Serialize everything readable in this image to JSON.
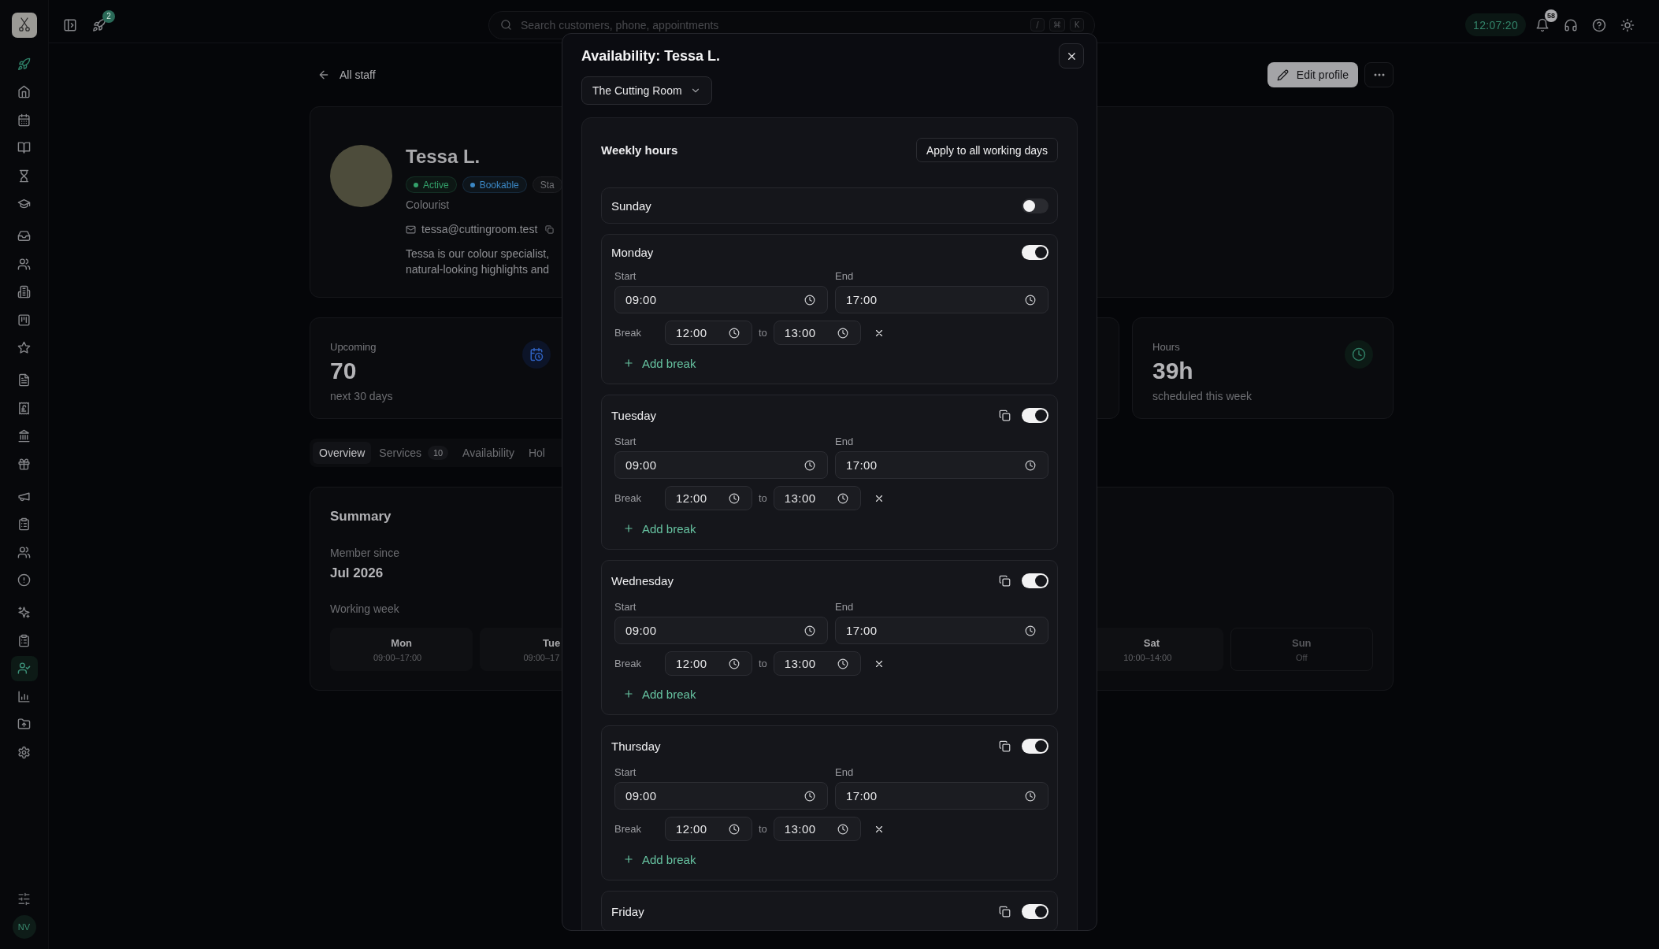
{
  "sidebar": {
    "groups": [
      [
        {
          "selected": false
        },
        {
          "selected": false
        },
        {
          "selected": false
        },
        {
          "selected": false
        },
        {
          "selected": false
        },
        {
          "selected": false
        }
      ],
      [
        {
          "selected": false
        },
        {
          "selected": false
        },
        {
          "selected": false
        },
        {
          "selected": false
        },
        {
          "selected": false
        }
      ],
      [
        {
          "selected": false
        },
        {
          "selected": false
        },
        {
          "selected": false
        },
        {
          "selected": false
        }
      ],
      [
        {
          "selected": false
        },
        {
          "selected": false
        },
        {
          "selected": false
        },
        {
          "selected": false
        }
      ],
      [
        {
          "selected": false
        },
        {
          "selected": false
        },
        {
          "selected": true
        },
        {
          "selected": false
        },
        {
          "selected": false
        },
        {
          "selected": false
        }
      ]
    ],
    "user_initials": "NV"
  },
  "top_bar": {
    "updates_badge": "2",
    "search": {
      "placeholder": "Search customers, phone, appointments",
      "shortcut_keys": [
        "/",
        "⌘",
        "K"
      ]
    },
    "clock": "12:07:20",
    "notifications_badge": "58"
  },
  "page": {
    "back_link": "All staff",
    "edit_button": "Edit profile",
    "profile": {
      "name": "Tessa L.",
      "badges": [
        {
          "label": "Active",
          "color": "#34a26b"
        },
        {
          "label": "Bookable",
          "color": "#3b87c4"
        },
        {
          "label": "Sta"
        }
      ],
      "role": "Colourist",
      "email": "tessa@cuttingroom.test",
      "bio_lines": [
        "Tessa is our colour specialist,",
        "natural-looking highlights and"
      ]
    },
    "stats": [
      {
        "kind": "calendar",
        "label": "Upcoming",
        "value": "70",
        "note": "next 30 days"
      },
      {
        "kind": "clock",
        "label": "Hours",
        "value": "39h",
        "note": "scheduled this week"
      }
    ],
    "tabs": [
      {
        "label": "Overview",
        "selected": true
      },
      {
        "label": "Services",
        "count": "10",
        "selected": false
      },
      {
        "label": "Availability",
        "selected": false
      },
      {
        "label": "Hol",
        "selected": false
      }
    ],
    "summary": {
      "title": "Summary",
      "member_since_label": "Member since",
      "member_since": "Jul 2026",
      "working_week_label": "Working week",
      "days": [
        {
          "day": "Mon",
          "hours": "09:00–17:00",
          "off": false
        },
        {
          "day": "Tue",
          "hours": "09:00–17",
          "off": false
        },
        {
          "day": "Sat",
          "hours": "10:00–14:00",
          "off": false
        },
        {
          "day": "Sun",
          "hours": "Off",
          "off": true
        }
      ]
    }
  },
  "modal": {
    "title": "Availability: Tessa L.",
    "location": "The Cutting Room",
    "section_title": "Weekly hours",
    "apply_button": "Apply to all working days",
    "days": [
      {
        "name": "Sunday",
        "on": false,
        "copy_button": false
      },
      {
        "name": "Monday",
        "on": true,
        "copy_button": false,
        "hours": {
          "start_label": "Start",
          "start": "09:00",
          "end_label": "End",
          "end": "17:00"
        },
        "breaks": [
          {
            "label": "Break",
            "start": "12:00",
            "separator": "to",
            "end": "13:00"
          }
        ],
        "add_break": "Add break"
      },
      {
        "name": "Tuesday",
        "on": true,
        "copy_button": true,
        "hours": {
          "start_label": "Start",
          "start": "09:00",
          "end_label": "End",
          "end": "17:00"
        },
        "breaks": [
          {
            "label": "Break",
            "start": "12:00",
            "separator": "to",
            "end": "13:00"
          }
        ],
        "add_break": "Add break"
      },
      {
        "name": "Wednesday",
        "on": true,
        "copy_button": true,
        "hours": {
          "start_label": "Start",
          "start": "09:00",
          "end_label": "End",
          "end": "17:00"
        },
        "breaks": [
          {
            "label": "Break",
            "start": "12:00",
            "separator": "to",
            "end": "13:00"
          }
        ],
        "add_break": "Add break"
      },
      {
        "name": "Thursday",
        "on": true,
        "copy_button": true,
        "hours": {
          "start_label": "Start",
          "start": "09:00",
          "end_label": "End",
          "end": "17:00"
        },
        "breaks": [
          {
            "label": "Break",
            "start": "12:00",
            "separator": "to",
            "end": "13:00"
          }
        ],
        "add_break": "Add break"
      },
      {
        "name": "Friday",
        "on": true,
        "copy_button": true
      }
    ]
  }
}
